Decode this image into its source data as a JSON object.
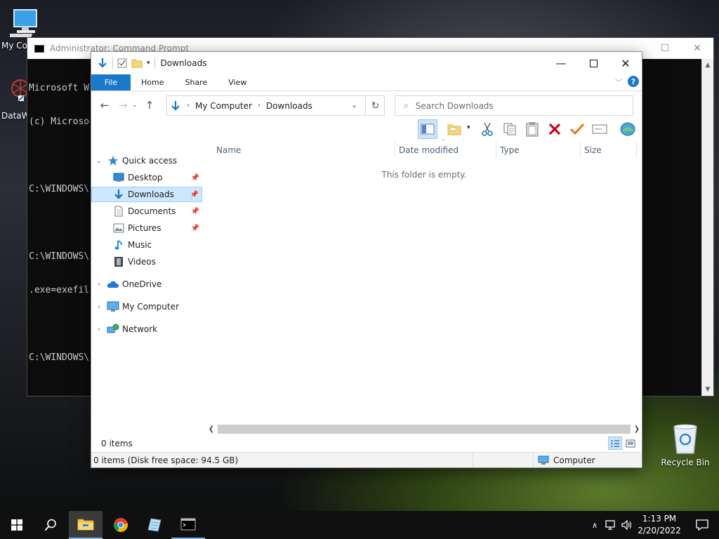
{
  "desktop": {
    "icons": [
      {
        "label": "My Co"
      },
      {
        "label": "DataW"
      },
      {
        "label": "Recycle Bin"
      }
    ]
  },
  "cmd": {
    "title": "Administrator: Command Prompt",
    "lines": [
      "Microsoft W",
      "(c) Microso",
      "",
      "C:\\WINDOWS\\",
      "",
      "C:\\WINDOWS\\",
      ".exe=exefil",
      "",
      "C:\\WINDOWS\\"
    ]
  },
  "explorer": {
    "title": "Downloads",
    "ribbon_tabs": {
      "file": "File",
      "home": "Home",
      "share": "Share",
      "view": "View"
    },
    "help_label": "?",
    "breadcrumb": [
      "My Computer",
      "Downloads"
    ],
    "search_placeholder": "Search Downloads",
    "columns": [
      "Name",
      "Date modified",
      "Type",
      "Size"
    ],
    "empty_message": "This folder is empty.",
    "nav": {
      "quick_access": "Quick access",
      "pinned": [
        {
          "label": "Desktop",
          "pinned": true
        },
        {
          "label": "Downloads",
          "pinned": true,
          "selected": true
        },
        {
          "label": "Documents",
          "pinned": true
        },
        {
          "label": "Pictures",
          "pinned": true
        },
        {
          "label": "Music",
          "pinned": false
        },
        {
          "label": "Videos",
          "pinned": false
        }
      ],
      "onedrive": "OneDrive",
      "my_computer": "My Computer",
      "network": "Network"
    },
    "item_count": "0 items",
    "status": {
      "left": "0 items (Disk free space: 94.5 GB)",
      "right": "Computer"
    }
  },
  "taskbar": {
    "time": "1:13 PM",
    "date": "2/20/2022"
  },
  "colors": {
    "accent": "#1979ca",
    "selection": "#cce8ff",
    "delete_red": "#d0021b",
    "check_orange": "#e07b16"
  }
}
